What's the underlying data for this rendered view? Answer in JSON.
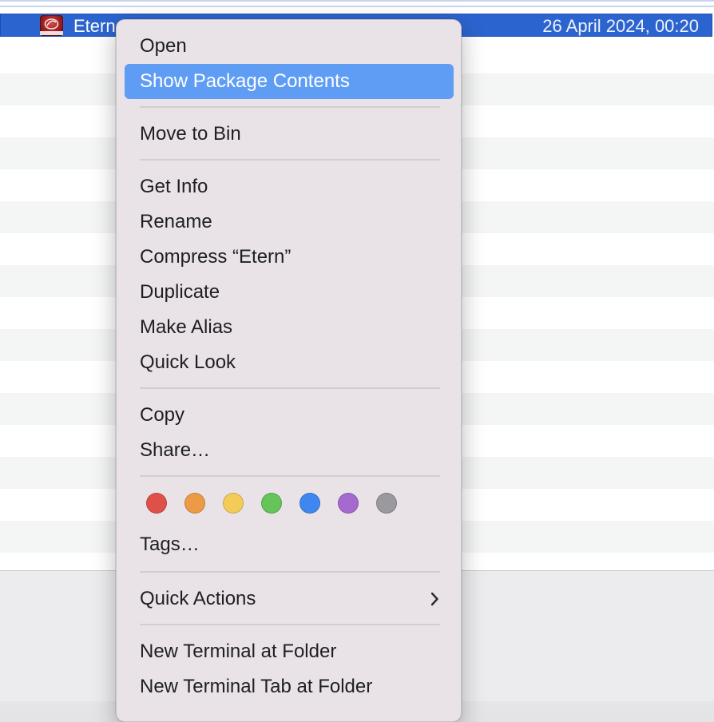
{
  "finder": {
    "selected_row": {
      "name": "Etern",
      "date_modified": "26 April 2024, 00:20",
      "icon": "wineskin-app-icon"
    }
  },
  "context_menu": {
    "items": [
      {
        "label": "Open",
        "state": "normal"
      },
      {
        "label": "Show Package Contents",
        "state": "highlighted"
      },
      {
        "label": "Move to Bin",
        "state": "normal"
      },
      {
        "label": "Get Info",
        "state": "normal"
      },
      {
        "label": "Rename",
        "state": "normal"
      },
      {
        "label": "Compress “Etern”",
        "state": "normal"
      },
      {
        "label": "Duplicate",
        "state": "normal"
      },
      {
        "label": "Make Alias",
        "state": "normal"
      },
      {
        "label": "Quick Look",
        "state": "normal"
      },
      {
        "label": "Copy",
        "state": "normal"
      },
      {
        "label": "Share…",
        "state": "normal"
      },
      {
        "label": "Tags…",
        "state": "normal"
      },
      {
        "label": "Quick Actions",
        "state": "submenu"
      },
      {
        "label": "New Terminal at Folder",
        "state": "normal"
      },
      {
        "label": "New Terminal Tab at Folder",
        "state": "normal"
      }
    ],
    "tag_colors": [
      {
        "name": "red",
        "color": "#e0504a"
      },
      {
        "name": "orange",
        "color": "#ed9a47"
      },
      {
        "name": "yellow",
        "color": "#f3cc58"
      },
      {
        "name": "green",
        "color": "#66c45a"
      },
      {
        "name": "blue",
        "color": "#3f87ef"
      },
      {
        "name": "purple",
        "color": "#a669cf"
      },
      {
        "name": "grey",
        "color": "#9a999d"
      }
    ],
    "highlight_color": "#5f9df5",
    "submenu_icon": "chevron-right-icon"
  }
}
